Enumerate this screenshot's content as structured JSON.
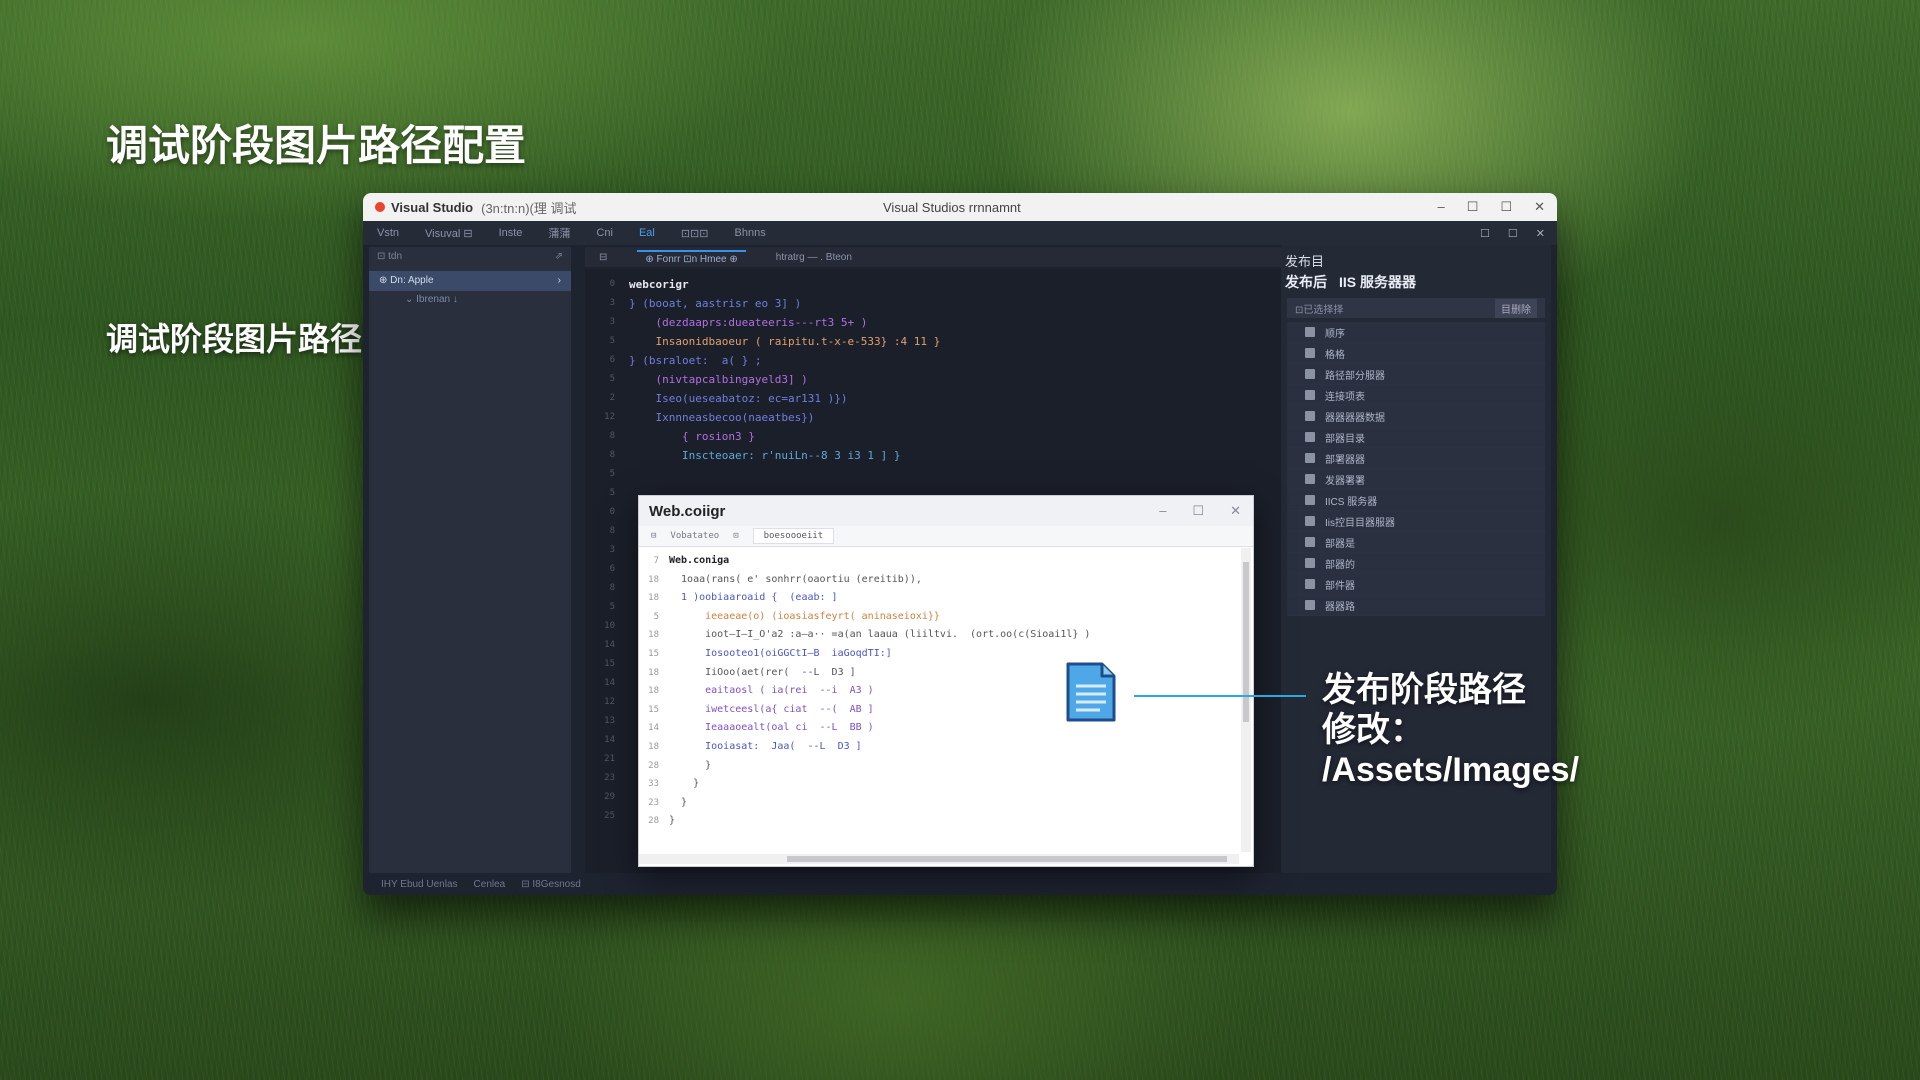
{
  "slide": {
    "title": "调试阶段图片路径配置",
    "left_caption": "调试阶段图片路径配置：~/Images/",
    "right_caption": [
      "发布阶段路径",
      "修改：",
      "/Assets/Images/"
    ]
  },
  "vs_window": {
    "app_name": "Visual Studio",
    "app_sub": "(3n:tn:n)(理 调试",
    "center_title": "Visual Studios rrnnamnt",
    "ctrls": [
      "–",
      "☐",
      "☐",
      "✕"
    ],
    "menu": [
      "Vstn",
      "Visuval  ⊟",
      "Inste",
      "蒲蒲",
      "Cni",
      "Eal",
      "⊡⊡⊡",
      "Bhnns"
    ],
    "menu_ctrls": [
      "☐",
      "☐",
      "✕"
    ],
    "sidebar": {
      "header": "⊡ tdn",
      "header_pin": "⇗",
      "selected": "⊕  Dn: Apple",
      "selected_arrow": "›",
      "child": "⌄  Ibrenan ↓"
    },
    "editor_tabs": [
      "⊟",
      "⊕ Fonrr  ⊡n Hmee  ⊕",
      "htratrg — . Bteon"
    ],
    "gutter": [
      "0",
      "3",
      "3",
      "5",
      "6",
      "5",
      "2",
      "12",
      "8",
      "8",
      "5",
      "5",
      "0",
      "8",
      "3",
      "6",
      "8",
      "5",
      "10",
      "14",
      "15",
      "14",
      "12",
      "13",
      "14",
      "21",
      "23",
      "29",
      "25"
    ],
    "code_lines": [
      {
        "indent": "",
        "text": "webcorigr",
        "style": "c-white"
      },
      {
        "indent": "",
        "text": "} (booat, aastrisr eo 3] )",
        "style": "c-blue"
      },
      {
        "indent": "    ",
        "text": "(dezdaaprs:dueateeris---rt3 5+ )",
        "style": "c-purple"
      },
      {
        "indent": "    ",
        "text": "Insaonidbaoeur ( raipitu.t-x-e-533} :4 11 }",
        "style": "c-orange"
      },
      {
        "indent": "",
        "text": "",
        "style": "c-blue"
      },
      {
        "indent": "",
        "text": "} (bsraloet:  a( } ;",
        "style": "c-blue"
      },
      {
        "indent": "    ",
        "text": "(nivtapcalbingayeld3] )",
        "style": "c-purple"
      },
      {
        "indent": "    ",
        "text": "Iseo(ueseabatoz: ec=ar131 )})",
        "style": "c-blue"
      },
      {
        "indent": "    ",
        "text": "Ixnnneasbecoo(naeatbes})",
        "style": "c-blue"
      },
      {
        "indent": "        ",
        "text": "{ rosion3 }",
        "style": "c-purple"
      },
      {
        "indent": "        ",
        "text": "Inscteoaer: r'nuiLn--8 3 i3 1 ] }",
        "style": "c-cyan"
      }
    ],
    "right_panel": {
      "title": "发布目",
      "tabs": [
        "发布后",
        "IIS 服务器器"
      ],
      "search_placeholder": "⊡已选择择",
      "search_button": "目删除",
      "items": [
        "顺序",
        "格格",
        "路径部分服器",
        "连接项表",
        "器器器器数据",
        "部器目录",
        "部署器器",
        "发器署署",
        "IICS 服务器",
        "Iis控目目器服器",
        "部器是",
        "部器的",
        "部件器",
        "器器路"
      ]
    },
    "statusbar": [
      "IHY Ebud  Uenlas",
      "Cenlea",
      "⊟ I8Gesnosd"
    ]
  },
  "webconfig_window": {
    "title": "Web.coiigr",
    "ctrls": [
      "–",
      "☐",
      "✕"
    ],
    "tabs": [
      "⊟",
      "Vobatateo",
      "⊡",
      "boesoooeiit"
    ],
    "gutter": [
      "7",
      "18",
      "18",
      "5",
      "18",
      "15",
      "18",
      "18",
      "15",
      "14",
      "18",
      "28",
      "33",
      "23",
      "28"
    ],
    "code_lines": [
      {
        "indent": "",
        "text": "Web.coniga",
        "style": "w-bold"
      },
      {
        "indent": "  ",
        "text": "1oaa(rans( e' sonhrr(oaortiu (ereitib)),",
        "style": "w-dark"
      },
      {
        "indent": "  ",
        "text": "1 )oobiaaroaid {  (eaab: ]",
        "style": "w-blue"
      },
      {
        "indent": "      ",
        "text": "ieeaeae(o) (ioasiasfeyrt( aninaseioxi}}",
        "style": "w-orange"
      },
      {
        "indent": "      ",
        "text": "ioot—I—I_O'a2 :a—a·· =a(an laaua (liiltvi.  (ort.oo(c(Sioai1l} )",
        "style": "w-dark"
      },
      {
        "indent": "      ",
        "text": "Iosooteo1(oiGGCtI—B  iaGoqdTI:]",
        "style": "w-blue"
      },
      {
        "indent": "      ",
        "text": "IiOoo(aet(rer(  --L  D3 ]",
        "style": "w-dark"
      },
      {
        "indent": "      ",
        "text": "eaitaosl ( ia(rei  --i  A3 )",
        "style": "w-purple"
      },
      {
        "indent": "      ",
        "text": "iwetceesl(a{ ciat  --(  AB ]",
        "style": "w-purple"
      },
      {
        "indent": "      ",
        "text": "Ieaaaoealt(oal ci  --L  BB )",
        "style": "w-purple"
      },
      {
        "indent": "      ",
        "text": "Iooiasat:  Jaa(  --L  D3 ]",
        "style": "w-blue"
      },
      {
        "indent": "      ",
        "text": "}",
        "style": "w-dark"
      },
      {
        "indent": "    ",
        "text": "}",
        "style": "w-dark"
      },
      {
        "indent": "  ",
        "text": "}",
        "style": "w-dark"
      },
      {
        "indent": "",
        "text": "}",
        "style": "w-dark"
      }
    ]
  },
  "colors": {
    "accent": "#2aa8e0",
    "doc_icon": "#4ea8e8"
  }
}
